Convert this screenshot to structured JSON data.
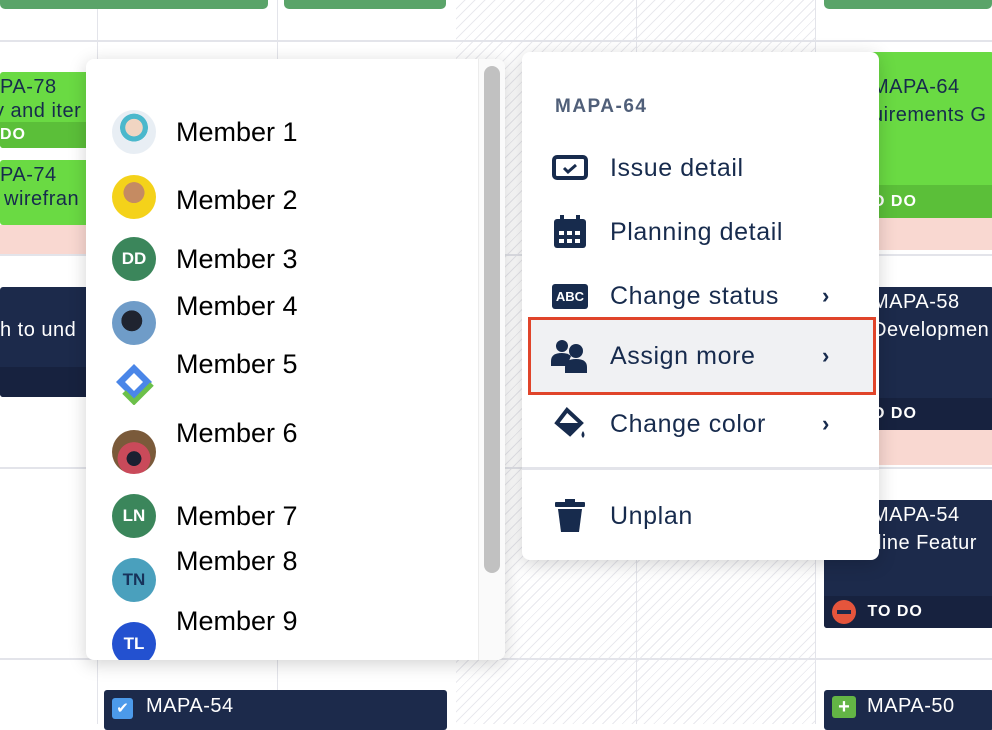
{
  "background_cards": {
    "left": [
      {
        "id": "PA-78",
        "title": "y and iter",
        "status": "DO"
      },
      {
        "id": "PA-74",
        "title": "wirefran"
      },
      {
        "title": "h to und"
      },
      {
        "id": "MAPA-54"
      }
    ],
    "right": [
      {
        "id": "MAPA-64",
        "title": "uirements G",
        "status": "O DO"
      },
      {
        "id": "MAPA-58",
        "title": "Developmen",
        "status": "O DO"
      },
      {
        "id": "MAPA-54",
        "title": "lline Featur",
        "status": "TO DO"
      },
      {
        "id": "MAPA-50"
      }
    ]
  },
  "members": [
    {
      "name": "Member 1",
      "avatar": "photo"
    },
    {
      "name": "Member 2",
      "avatar": "photo"
    },
    {
      "name": "Member 3",
      "initials": "DD",
      "color": "#3b865b"
    },
    {
      "name": "Member 4",
      "avatar": "photo"
    },
    {
      "name": "Member 5",
      "avatar": "logo"
    },
    {
      "name": "Member 6",
      "avatar": "photo"
    },
    {
      "name": "Member 7",
      "initials": "LN",
      "color": "#3b865b"
    },
    {
      "name": "Member 8",
      "initials": "TN",
      "color": "#4aa0bd"
    },
    {
      "name": "Member 9",
      "initials": "TL",
      "color": "#2351d0"
    }
  ],
  "context_menu": {
    "title": "MAPA-64",
    "items": [
      {
        "label": "Issue detail",
        "icon": "issue-card-icon"
      },
      {
        "label": "Planning detail",
        "icon": "calendar-icon"
      },
      {
        "label": "Change status",
        "icon": "abc-icon",
        "submenu": true
      },
      {
        "label": "Assign more",
        "icon": "users-icon",
        "submenu": true,
        "highlighted": true
      },
      {
        "label": "Change color",
        "icon": "paint-bucket-icon",
        "submenu": true
      },
      {
        "label": "Unplan",
        "icon": "trash-icon"
      }
    ],
    "abc_glyph": "ABC",
    "chevron": "›"
  },
  "colors": {
    "highlight_border": "#e0442a",
    "text": "#172b4d",
    "navy": "#1c2a4b",
    "green": "#6ada43"
  }
}
